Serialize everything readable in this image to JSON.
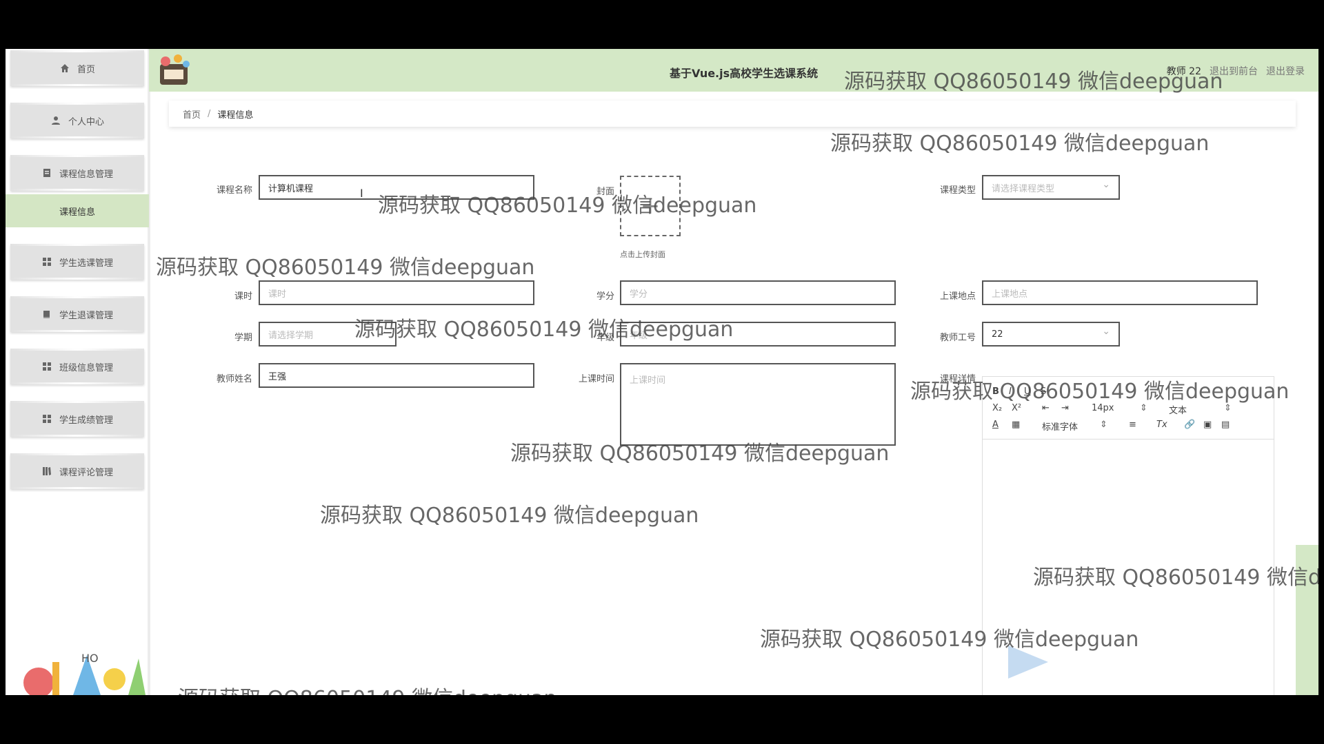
{
  "header": {
    "title": "基于Vue.js高校学生选课系统",
    "user": "教师 22",
    "back_to_front": "退出到前台",
    "logout": "退出登录"
  },
  "sidebar": {
    "items": [
      {
        "label": "首页",
        "icon": "home-icon"
      },
      {
        "label": "个人中心",
        "icon": "user-icon"
      },
      {
        "label": "课程信息管理",
        "icon": "clipboard-icon"
      },
      {
        "label": "学生选课管理",
        "icon": "grid-icon"
      },
      {
        "label": "学生退课管理",
        "icon": "book-icon"
      },
      {
        "label": "班级信息管理",
        "icon": "grid-icon"
      },
      {
        "label": "学生成绩管理",
        "icon": "grid-icon"
      },
      {
        "label": "课程评论管理",
        "icon": "library-icon"
      }
    ],
    "active_sub": "课程信息"
  },
  "breadcrumb": {
    "home": "首页",
    "separator": "/",
    "current": "课程信息"
  },
  "form": {
    "course_name": {
      "label": "课程名称",
      "value": "计算机课程"
    },
    "cover": {
      "label": "封面",
      "hint": "点击上传封面"
    },
    "course_type": {
      "label": "课程类型",
      "placeholder": "请选择课程类型"
    },
    "hours": {
      "label": "课时",
      "placeholder": "课时"
    },
    "credit": {
      "label": "学分",
      "placeholder": "学分"
    },
    "location": {
      "label": "上课地点",
      "placeholder": "上课地点"
    },
    "semester": {
      "label": "学期",
      "placeholder": "请选择学期"
    },
    "grade": {
      "label": "年级",
      "placeholder": "年级"
    },
    "teacher_id": {
      "label": "教师工号",
      "value": "22"
    },
    "teacher_name": {
      "label": "教师姓名",
      "value": "王强"
    },
    "class_time": {
      "label": "上课时间",
      "placeholder": "上课时间"
    },
    "details": {
      "label": "课程详情"
    }
  },
  "editor": {
    "font_size": "14px",
    "block_type": "文本",
    "font_family": "标准字体"
  },
  "watermark": "源码获取 QQ86050149 微信deepguan"
}
